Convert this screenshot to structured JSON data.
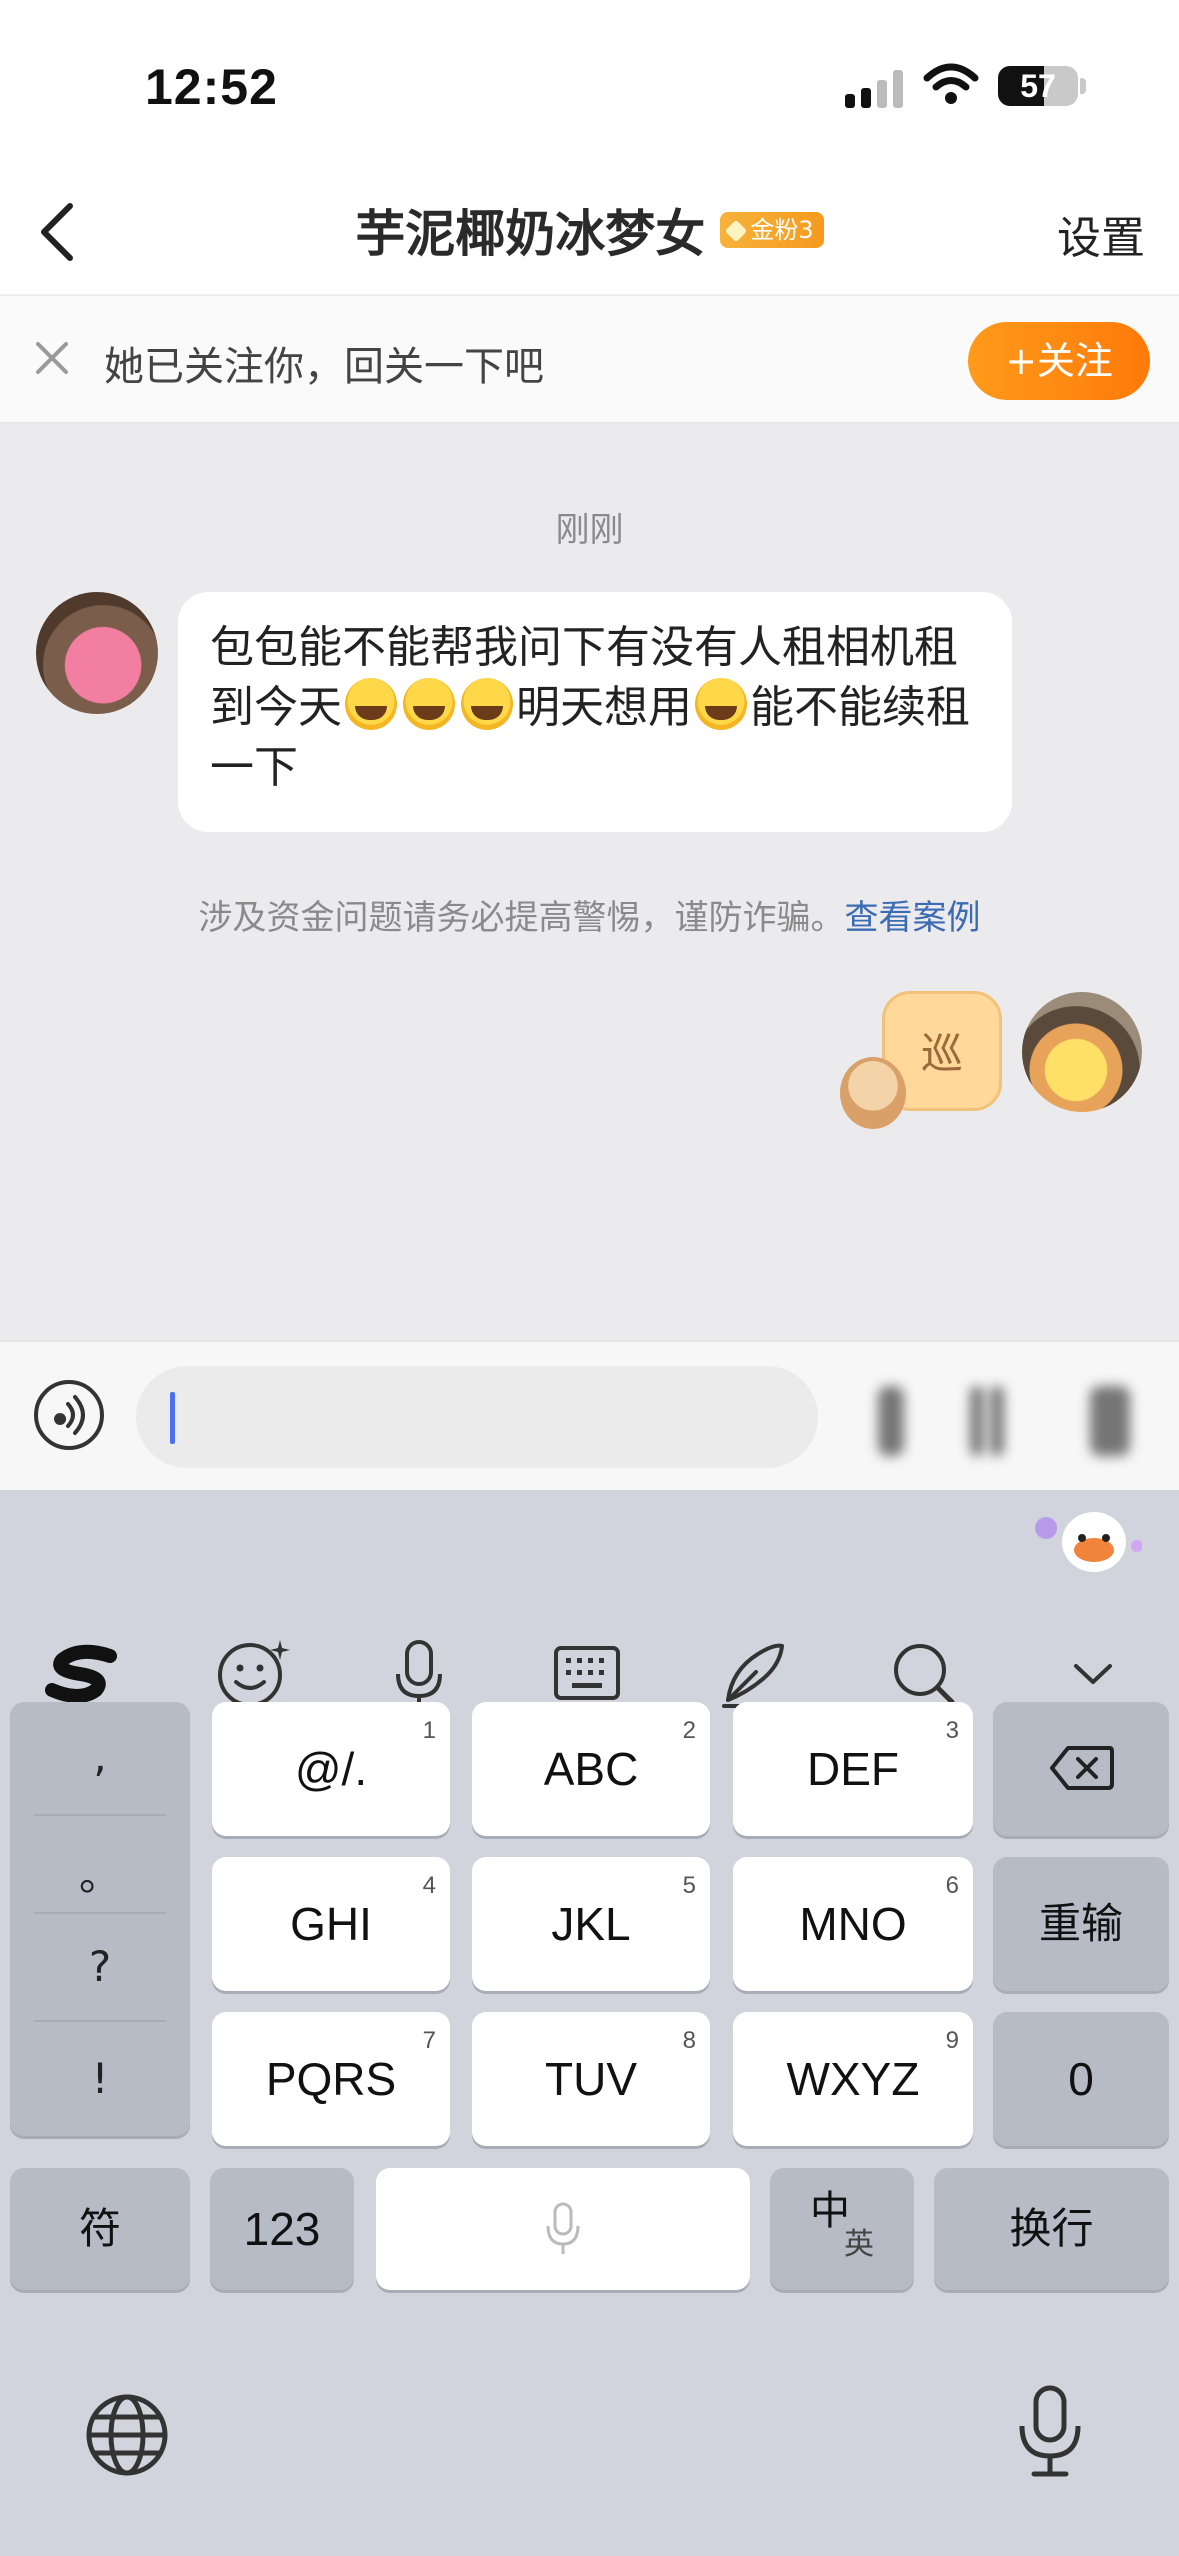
{
  "status_bar": {
    "time": "12:52",
    "battery": "57",
    "battery_fraction": 0.57
  },
  "nav": {
    "title": "芋泥椰奶冰梦女",
    "fan_badge": "金粉3",
    "settings": "设置"
  },
  "follow_banner": {
    "text": "她已关注你，回关一下吧",
    "button": "+关注"
  },
  "chat": {
    "timestamp": "刚刚",
    "incoming": {
      "text_before": "包包能不能帮我问下有没有人租相机租到今天",
      "text_middle": "明天想用",
      "text_after": "能不能续租一下"
    },
    "warning": {
      "text": "涉及资金问题请务必提高警惕，谨防诈骗。",
      "link": "查看案例"
    },
    "outgoing_sticker": {
      "char": "巡"
    }
  },
  "keyboard": {
    "punctuation": [
      ",",
      "。",
      "?",
      "!"
    ],
    "keys": [
      {
        "label": "@/.",
        "num": "1"
      },
      {
        "label": "ABC",
        "num": "2"
      },
      {
        "label": "DEF",
        "num": "3"
      },
      {
        "label": "GHI",
        "num": "4"
      },
      {
        "label": "JKL",
        "num": "5"
      },
      {
        "label": "MNO",
        "num": "6"
      },
      {
        "label": "PQRS",
        "num": "7"
      },
      {
        "label": "TUV",
        "num": "8"
      },
      {
        "label": "WXYZ",
        "num": "9"
      }
    ],
    "retype": "重输",
    "zero": "0",
    "symbols": "符",
    "numbers": "123",
    "lang_primary": "中",
    "lang_secondary": "英",
    "newline": "换行"
  }
}
